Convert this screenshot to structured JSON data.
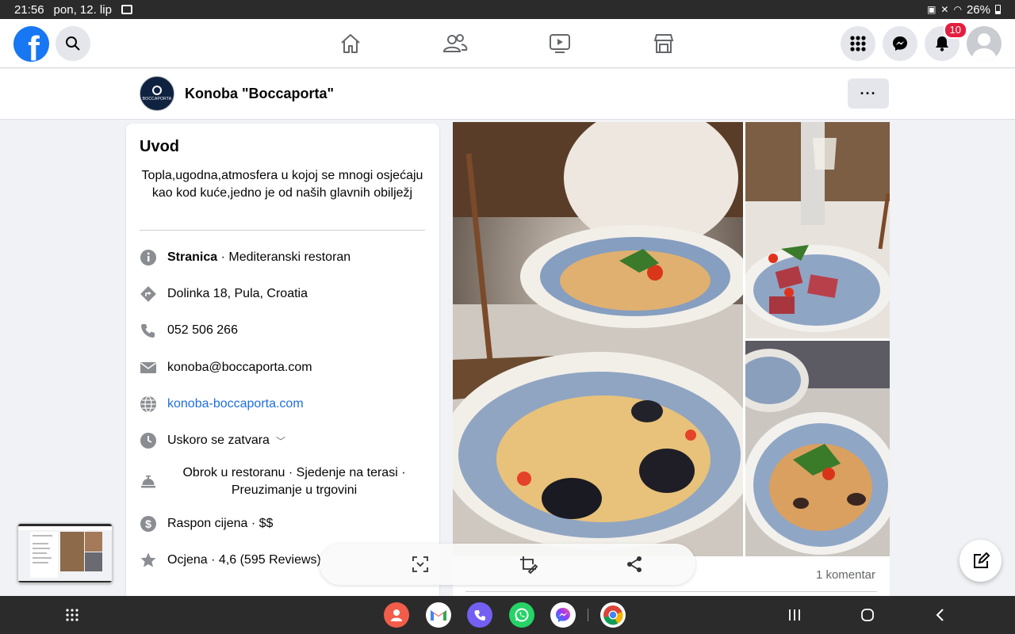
{
  "status_bar": {
    "time": "21:56",
    "date": "pon, 12. lip",
    "battery": "26%"
  },
  "topnav": {
    "logo": "f",
    "notifications_count": "10"
  },
  "page_header": {
    "page_name": "Konoba \"Boccaporta\"",
    "avatar_text": "BOCCAPORTA",
    "more_label": "···"
  },
  "intro": {
    "title": "Uvod",
    "description": "Topla,ugodna,atmosfera u kojoj se mnogi osjećaju kao kod kuće,jedno je od naših glavnih obilježj",
    "category_label": "Stranica",
    "category_value": " · Mediteranski restoran",
    "address": "Dolinka 18, Pula, Croatia",
    "phone": "052 506 266",
    "email": "konoba@boccaporta.com",
    "website": "konoba-boccaporta.com",
    "hours": "Uskoro se zatvara",
    "services": "Obrok u restoranu · Sjedenje na terasi · Preuzimanje u trgovini",
    "price_range": "Raspon cijena · $$",
    "rating": "Ocjena · 4,6 (595 Reviews)"
  },
  "post": {
    "comments": "1 komentar"
  },
  "icons": {
    "info": "info-icon",
    "directions": "directions-icon",
    "phone": "phone-icon",
    "email": "envelope-icon",
    "website": "globe-icon",
    "hours": "clock-icon",
    "services": "service-bell-icon",
    "price": "dollar-icon",
    "rating": "star-icon"
  },
  "colors": {
    "fb_blue": "#1877f2",
    "link": "#216fdb",
    "badge": "#e41e3f"
  }
}
